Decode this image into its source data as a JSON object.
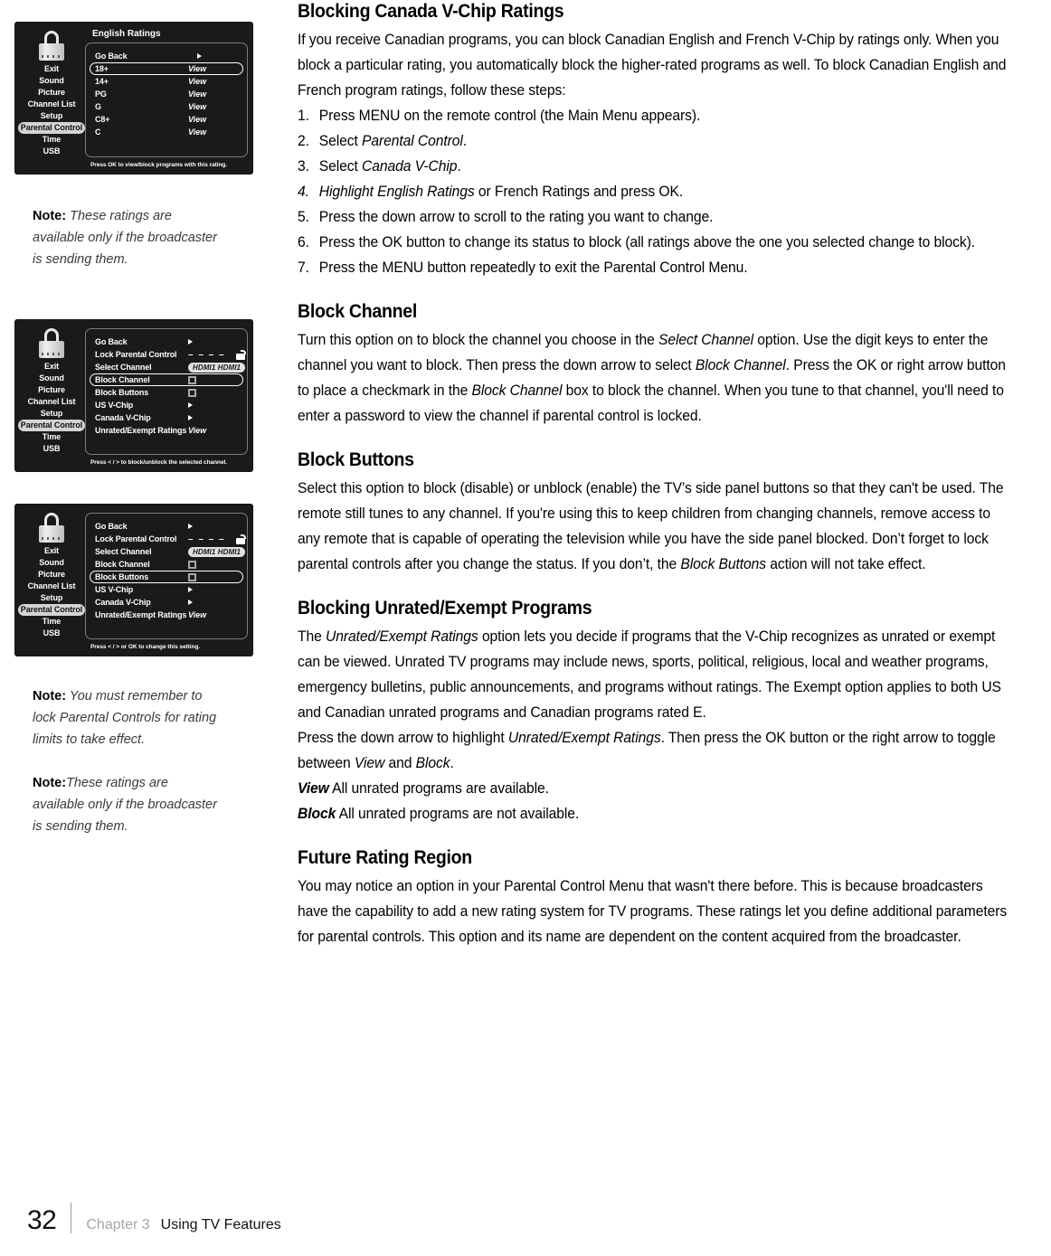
{
  "page": {
    "number": "32",
    "chapter": "Chapter 3",
    "chapter_title": "Using TV Features"
  },
  "screenshots": [
    {
      "id": "english-ratings",
      "title": "English Ratings",
      "sidebar": [
        "Exit",
        "Sound",
        "Picture",
        "Channel List",
        "Setup",
        "Parental Control",
        "Time",
        "USB"
      ],
      "selected_sidebar": "Parental Control",
      "rows": [
        {
          "label": "Go Back",
          "value": "",
          "kind": "arrow",
          "highlight": false
        },
        {
          "label": "18+",
          "value": "View",
          "kind": "text",
          "highlight": true
        },
        {
          "label": "14+",
          "value": "View",
          "kind": "text",
          "highlight": false
        },
        {
          "label": "PG",
          "value": "View",
          "kind": "text",
          "highlight": false
        },
        {
          "label": "G",
          "value": "View",
          "kind": "text",
          "highlight": false
        },
        {
          "label": "C8+",
          "value": "View",
          "kind": "text",
          "highlight": false
        },
        {
          "label": "C",
          "value": "View",
          "kind": "text",
          "highlight": false
        }
      ],
      "hint": "Press OK to view/block programs with this rating."
    },
    {
      "id": "block-channel-menu",
      "title": "",
      "sidebar": [
        "Exit",
        "Sound",
        "Picture",
        "Channel List",
        "Setup",
        "Parental Control",
        "Time",
        "USB"
      ],
      "selected_sidebar": "Parental Control",
      "rows": [
        {
          "label": "Go Back",
          "value": "",
          "kind": "arrow",
          "highlight": false
        },
        {
          "label": "Lock Parental Control",
          "value": "– – – –",
          "kind": "lockcode",
          "highlight": false
        },
        {
          "label": "Select Channel",
          "value": "HDMI1  HDMI1",
          "kind": "pill",
          "highlight": false
        },
        {
          "label": "Block Channel",
          "value": "",
          "kind": "checkbox",
          "highlight": true
        },
        {
          "label": "Block Buttons",
          "value": "",
          "kind": "checkbox",
          "highlight": false
        },
        {
          "label": "US V-Chip",
          "value": "",
          "kind": "arrow",
          "highlight": false
        },
        {
          "label": "Canada V-Chip",
          "value": "",
          "kind": "arrow",
          "highlight": false
        },
        {
          "label": "Unrated/Exempt Ratings",
          "value": "View",
          "kind": "text",
          "highlight": false
        }
      ],
      "hint": "Press < / > to block/unblock the selected channel."
    },
    {
      "id": "block-buttons-menu",
      "title": "",
      "sidebar": [
        "Exit",
        "Sound",
        "Picture",
        "Channel List",
        "Setup",
        "Parental Control",
        "Time",
        "USB"
      ],
      "selected_sidebar": "Parental Control",
      "rows": [
        {
          "label": "Go Back",
          "value": "",
          "kind": "arrow",
          "highlight": false
        },
        {
          "label": "Lock Parental Control",
          "value": "– – – –",
          "kind": "lockcode",
          "highlight": false
        },
        {
          "label": "Select Channel",
          "value": "HDMI1  HDMI1",
          "kind": "pill",
          "highlight": false
        },
        {
          "label": "Block Channel",
          "value": "",
          "kind": "checkbox",
          "highlight": false
        },
        {
          "label": "Block Buttons",
          "value": "",
          "kind": "checkbox",
          "highlight": true
        },
        {
          "label": "US V-Chip",
          "value": "",
          "kind": "arrow",
          "highlight": false
        },
        {
          "label": "Canada V-Chip",
          "value": "",
          "kind": "arrow",
          "highlight": false
        },
        {
          "label": "Unrated/Exempt Ratings",
          "value": "View",
          "kind": "text",
          "highlight": false
        }
      ],
      "hint": "Press < / >  or OK to change this setting."
    }
  ],
  "notes": [
    {
      "id": "note-1",
      "label": "Note:",
      "text": " These ratings are available only if the broadcaster is sending them."
    },
    {
      "id": "note-2",
      "label": "Note:",
      "text": " You must remember to lock Parental Controls for rating limits to take effect."
    },
    {
      "id": "note-3",
      "label": "Note:",
      "text": "These ratings are available only if the broadcaster is sending them."
    }
  ],
  "sections": [
    {
      "id": "blocking-canada-vchip",
      "heading": "Blocking Canada V-Chip Ratings",
      "intro": "If you receive Canadian programs, you can block Canadian English and French V-Chip by ratings only. When you block a particular rating, you automatically block the higher-rated programs as well. To block Canadian English and French program ratings, follow these steps:",
      "steps": [
        {
          "pre": "Press MENU on the remote control (the Main Menu appears).",
          "em": "",
          "post": ""
        },
        {
          "pre": "Select ",
          "em": "Parental Control",
          "post": "."
        },
        {
          "pre": "Select ",
          "em": "Canada V-Chip",
          "post": "."
        },
        {
          "pre": "Highlight English Ratings",
          "em": " or French Ratings ",
          "post": "and press OK."
        },
        {
          "pre": "Press the down arrow to scroll to the rating you want to change.",
          "em": "",
          "post": ""
        },
        {
          "pre": "Press the OK button to change its status to block (all ratings above the one you selected change to block).",
          "em": "",
          "post": ""
        },
        {
          "pre": "Press the MENU button repeatedly to exit the Parental Control Menu.",
          "em": "",
          "post": ""
        }
      ]
    },
    {
      "id": "block-channel",
      "heading": "Block Channel",
      "para_1": "Turn this option on to block the channel you choose in the ",
      "em_1": "Select Channel",
      "para_2": " option. Use the digit keys to enter the channel you want to block. Then press the down arrow to select ",
      "em_2": "Block Channel",
      "para_3": ". Press the OK or right arrow button to place a checkmark in the ",
      "em_3": "Block Channel",
      "para_4": " box to block the channel. When you tune to that channel, you'll need to enter a password to view the channel if parental control is locked."
    },
    {
      "id": "block-buttons",
      "heading": "Block Buttons",
      "para_1": "Select this option to block (disable) or unblock (enable) the TV’s side panel buttons so that they can't be used. The remote still tunes to any channel. If you're using this to keep children from changing channels, remove access to any remote that is capable of operating the television while you have the side panel blocked. Don’t forget to lock parental controls after you change the status. If you don’t, the ",
      "em_1": "Block Buttons",
      "para_2": " action will not take effect."
    },
    {
      "id": "blocking-unrated-exempt",
      "heading": "Blocking Unrated/Exempt Programs",
      "para_1": "The ",
      "em_1": "Unrated/Exempt Ratings",
      "para_2": " option lets you decide if programs that the V-Chip recognizes as unrated or exempt can be viewed. Unrated TV programs may include news, sports, political, religious, local and weather programs, emergency bulletins, public announcements, and programs without ratings. The Exempt option applies to both US and Canadian unrated programs and Canadian programs rated E.",
      "para_3": "Press the down arrow to highlight ",
      "em_2": "Unrated/Exempt Ratings",
      "para_4": ". Then press the OK button or the right arrow to toggle between ",
      "em_3": "View",
      "para_5": " and ",
      "em_4": "Block",
      "para_6": ".",
      "definitions": [
        {
          "term": "View",
          "desc": "  All unrated programs are available."
        },
        {
          "term": "Block",
          "desc": "  All unrated programs are not available."
        }
      ]
    },
    {
      "id": "future-rating-region",
      "heading": "Future Rating Region",
      "para_1": "You may notice an option in your Parental Control Menu that wasn't there before. This is because broadcasters have the capability to add a new rating system for TV programs. These ratings let you define additional parameters for parental controls. This option and its name are dependent on the content acquired from the broadcaster."
    }
  ]
}
